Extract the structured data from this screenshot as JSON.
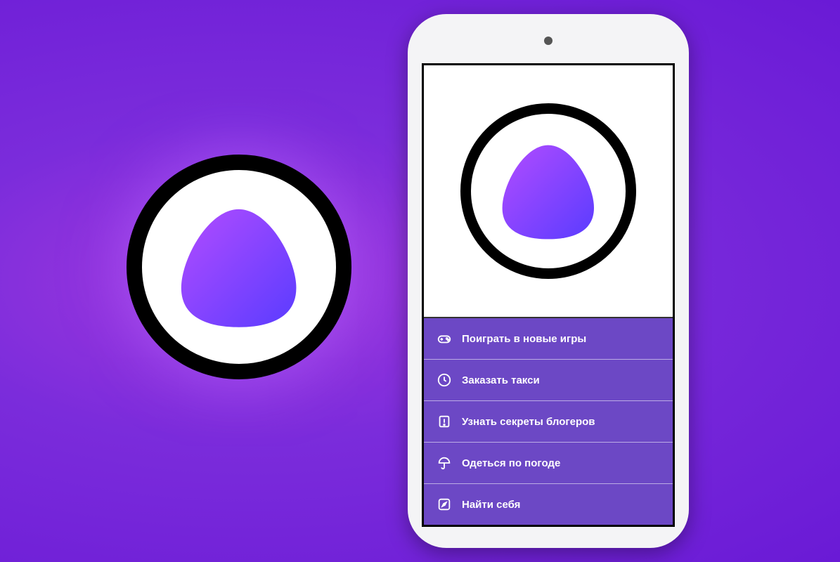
{
  "logo": {
    "name": "alice-logo"
  },
  "menu": {
    "items": [
      {
        "icon": "gamepad-icon",
        "label": "Поиграть в новые игры"
      },
      {
        "icon": "taxi-icon",
        "label": "Заказать такси"
      },
      {
        "icon": "book-icon",
        "label": "Узнать секреты блогеров"
      },
      {
        "icon": "umbrella-icon",
        "label": "Одеться по погоде"
      },
      {
        "icon": "compass-icon",
        "label": "Найти себя"
      }
    ]
  },
  "colors": {
    "bg_gradient_inner": "#a23adf",
    "bg_gradient_outer": "#6a1ad6",
    "menu_bg": "#6c48c5",
    "logo_grad_a": "#b24cff",
    "logo_grad_b": "#5a3cff"
  }
}
